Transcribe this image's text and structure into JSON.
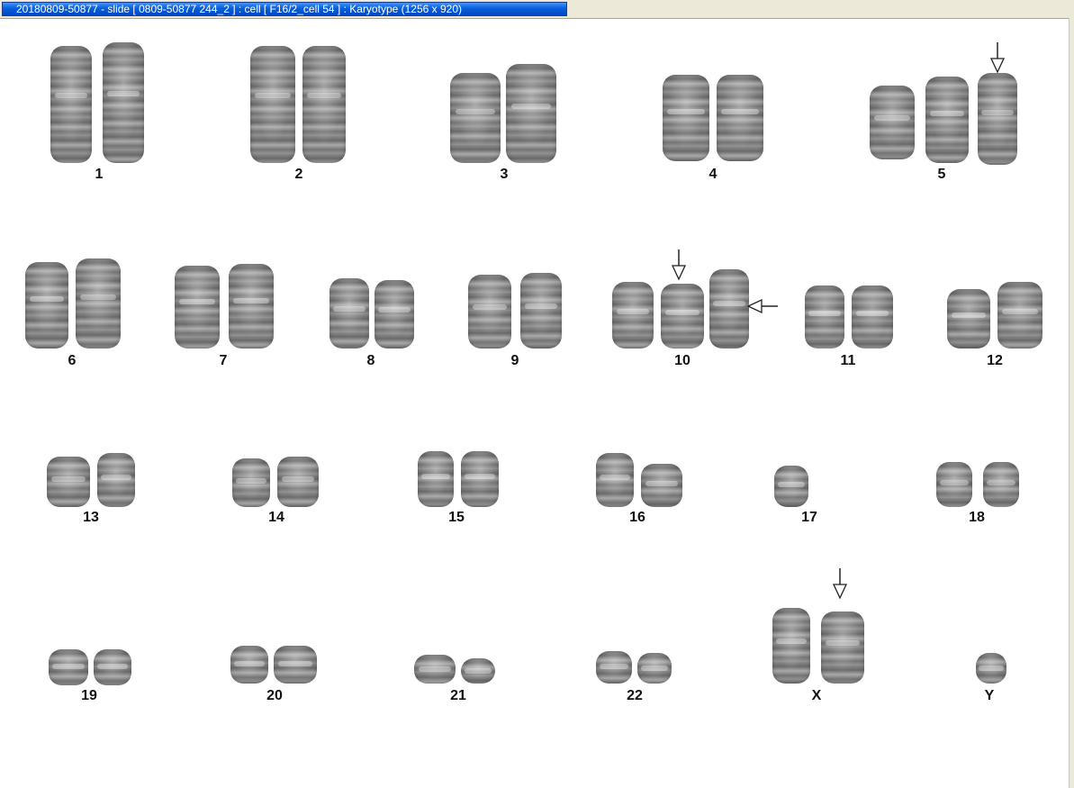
{
  "window": {
    "title": "20180809-50877 - slide [ 0809-50877 244_2 ] : cell [ F16/2_cell 54 ] : Karyotype  (1256 x 920)"
  },
  "karyotype": {
    "labels": {
      "c1": "1",
      "c2": "2",
      "c3": "3",
      "c4": "4",
      "c5": "5",
      "c6": "6",
      "c7": "7",
      "c8": "8",
      "c9": "9",
      "c10": "10",
      "c11": "11",
      "c12": "12",
      "c13": "13",
      "c14": "14",
      "c15": "15",
      "c16": "16",
      "c17": "17",
      "c18": "18",
      "c19": "19",
      "c20": "20",
      "c21": "21",
      "c22": "22",
      "cX": "X",
      "cY": "Y"
    }
  },
  "icons": {
    "abnormality_marker_down": "arrow-down-icon",
    "abnormality_marker_left": "arrow-left-icon"
  }
}
